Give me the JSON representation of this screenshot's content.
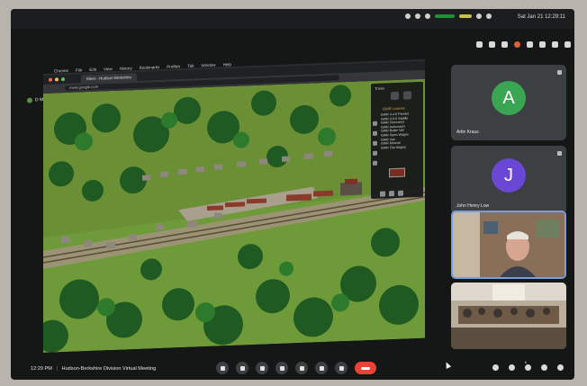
{
  "menubar": {
    "clock": "Sat Jan 21 12:29:11"
  },
  "chrome": {
    "menu_items": [
      "Chrome",
      "File",
      "Edit",
      "View",
      "History",
      "Bookmarks",
      "Profiles",
      "Tab",
      "Window",
      "Help"
    ],
    "tab_title": "Meet - Hudson-Berkshire",
    "url": "meet.google.com"
  },
  "presenting": {
    "label": "D M is presenting"
  },
  "game_palette": {
    "title": "Trains",
    "section_label": "GWR Liveries",
    "items": [
      "GWR 4-4-0 Pannier",
      "GWR 0-6-0 Saddle",
      "GWR Clerestory",
      "GWR Autocoach",
      "GWR Brake Van",
      "GWR Open Wagon",
      "GWR Van",
      "GWR Mineral",
      "GWR Flat Wagon"
    ]
  },
  "participants": [
    {
      "type": "avatar",
      "initial": "A",
      "name": "Artin Kraus",
      "color": "#3aa653"
    },
    {
      "type": "avatar",
      "initial": "J",
      "name": "John Henry Low",
      "color": "#6b47d6"
    },
    {
      "type": "video",
      "name": "",
      "label": "Participant video"
    },
    {
      "type": "video",
      "name": "",
      "label": "Room video"
    }
  ],
  "bottombar": {
    "time": "12:29 PM",
    "meeting_name": "Hudson-Berkshire Division Virtual Meeting",
    "participant_count": "6"
  }
}
